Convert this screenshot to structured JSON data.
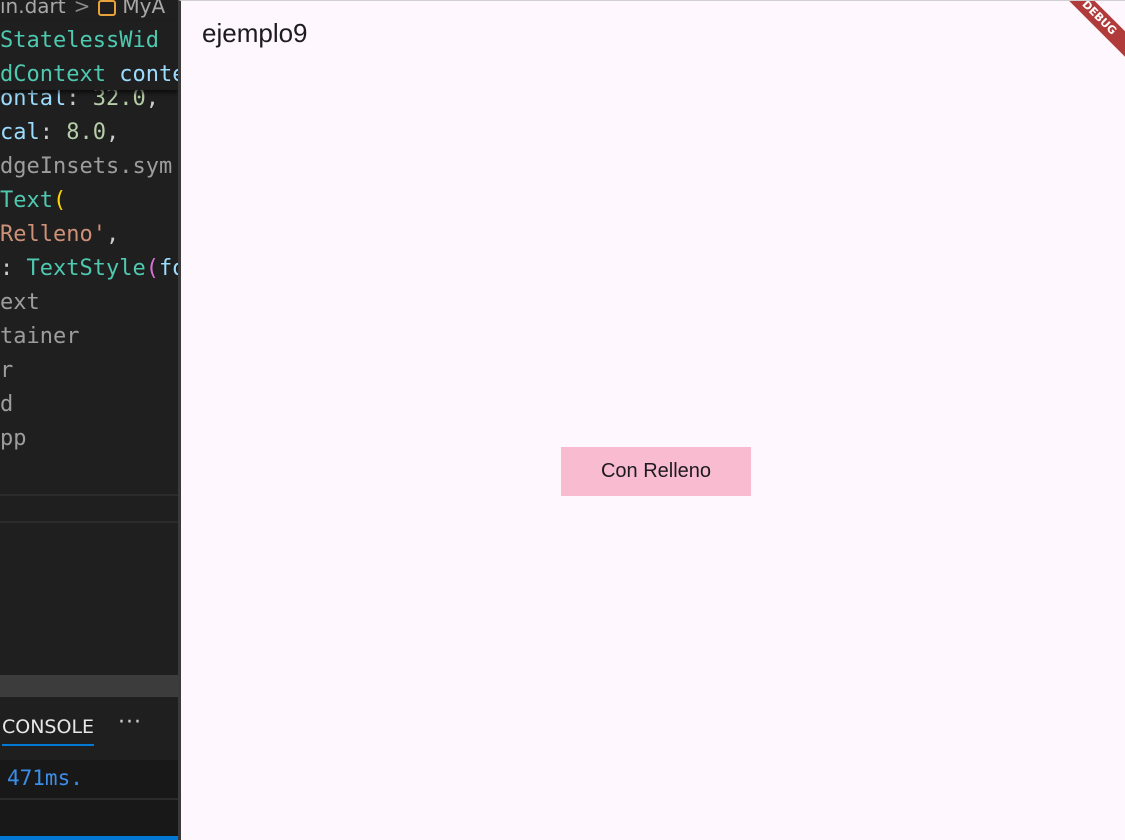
{
  "editor": {
    "breadcrumb": {
      "file": "in.dart",
      "separator": ">",
      "symbol": "MyA",
      "symbol_icon": "symbol-class-icon"
    },
    "sticky_lines": [
      {
        "a": " StatelessWid",
        "b": ""
      },
      {
        "a": "dContext",
        "b": " conte"
      }
    ],
    "lines": [
      {
        "a": "ontal",
        "b": ": ",
        "c": "32.0",
        "d": ","
      },
      {
        "a": "cal",
        "b": ": ",
        "c": "8.0",
        "d": ","
      },
      {
        "a": "dgeInsets.sym"
      },
      {
        "a": "Text",
        "b": "("
      },
      {
        "a": "Relleno'",
        "b": ","
      },
      {
        "a": ": ",
        "b": "TextStyle",
        "c": "(",
        "d": "fo"
      },
      {
        "a": "ext"
      },
      {
        "a": "tainer"
      },
      {
        "a": "r"
      },
      {
        "a": "d"
      },
      {
        "a": "pp"
      }
    ]
  },
  "panel": {
    "tab_label": "CONSOLE",
    "more_label": "···",
    "output_line": " 471ms."
  },
  "app": {
    "title": "ejemplo9",
    "box_label": "Con Relleno",
    "box_color": "#f8bbd0",
    "background": "#fef7fd",
    "debug_label": "DEBUG"
  }
}
